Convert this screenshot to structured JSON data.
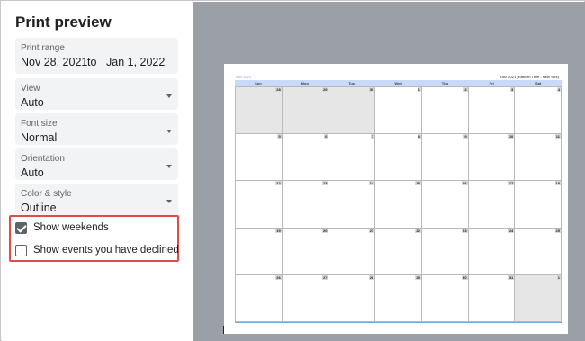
{
  "panel": {
    "title": "Print preview",
    "print_range": {
      "label": "Print range",
      "from": "Nov 28, 2021",
      "to_word": "to",
      "to": "Jan 1, 2022"
    },
    "view": {
      "label": "View",
      "value": "Auto"
    },
    "font_size": {
      "label": "Font size",
      "value": "Normal"
    },
    "orientation": {
      "label": "Orientation",
      "value": "Auto"
    },
    "color_style": {
      "label": "Color & style",
      "value": "Outline"
    },
    "show_weekends": {
      "label": "Show weekends",
      "checked": true
    },
    "show_declined": {
      "label": "Show events you have declined",
      "checked": false
    }
  },
  "preview": {
    "header_left": "Nov 2021",
    "header_right": "Dec 2021 (Eastern Time - New York)",
    "weekdays": [
      "Sun",
      "Mon",
      "Tue",
      "Wed",
      "Thu",
      "Fri",
      "Sat"
    ],
    "weeks": [
      [
        "28",
        "29",
        "30",
        "1",
        "2",
        "3",
        "4"
      ],
      [
        "5",
        "6",
        "7",
        "8",
        "9",
        "10",
        "11"
      ],
      [
        "12",
        "13",
        "14",
        "15",
        "16",
        "17",
        "18"
      ],
      [
        "19",
        "20",
        "21",
        "22",
        "23",
        "24",
        "25"
      ],
      [
        "26",
        "27",
        "28",
        "29",
        "30",
        "31",
        "1"
      ]
    ]
  },
  "colors": {
    "highlight_border": "#e04a4a",
    "preview_background": "#9aa0a6",
    "weekday_header": "#c9daf8"
  }
}
